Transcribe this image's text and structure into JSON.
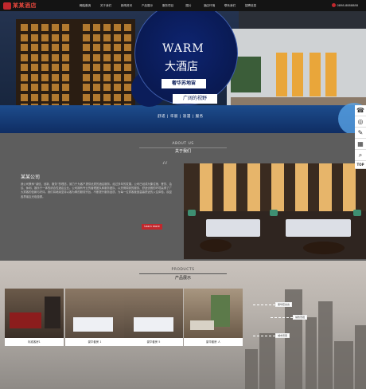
{
  "header": {
    "logo": "某某酒店",
    "nav": [
      "网站首页",
      "关于我们",
      "新闻资讯",
      "产品展示",
      "服务项目",
      "图片",
      "酒店环境",
      "联系我们",
      "招聘信息"
    ],
    "phone": "0898-8888888"
  },
  "hero": {
    "title": "WARM",
    "subtitle": "大酒店",
    "tag1": "奢华苏地宙",
    "tag2": "广阔的视野",
    "footer": "舒适 | 华丽 | 浪漫 | 服务"
  },
  "sidebar": {
    "items": [
      "phone-icon",
      "chat-icon",
      "edit-icon",
      "qr-icon",
      "search-icon"
    ],
    "top": "TOP"
  },
  "about": {
    "en": "ABOUT US",
    "cn": "关于我们",
    "company": "某某公司",
    "text": "我公司秉承“诚信、创新、服务”的理念，致力于为客户提供优质的酒店服务。经过多年的发展，公司已经成为集住宿、餐饮、会议、休闲、娱乐于一体的综合性酒店企业。公司拥有专业的管理团队和服务团队，以热情周到的服务、舒适优雅的环境赢得了广大宾客的信赖与好评。我们将继续坚持以客为尊的服务宗旨，不断提升服务品质，为每一位宾客营造温馨舒适的入住体验，欢迎各界朋友光临惠顾。",
    "more": "Learn more"
  },
  "products": {
    "en": "PRODUCTS",
    "cn": "产品展示",
    "items": [
      "标准客房1",
      "豪华套房 1",
      "豪华套房 5",
      "豪华套房 人"
    ],
    "callouts": [
      "豪华套房房",
      "城市景观",
      "城市景观"
    ]
  }
}
